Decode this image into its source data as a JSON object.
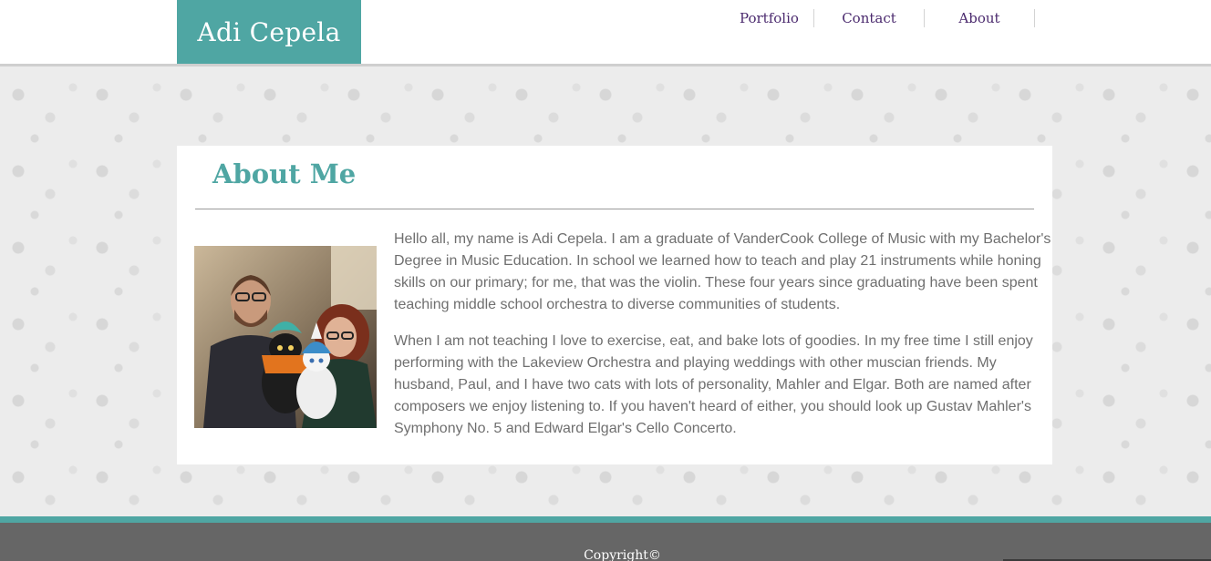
{
  "header": {
    "brand": "Adi Cepela",
    "nav": {
      "portfolio": "Portfolio",
      "contact": "Contact",
      "about": "About"
    }
  },
  "main": {
    "title": "About Me",
    "paragraphs": [
      "Hello all, my name is Adi Cepela. I am a graduate of VanderCook College of Music with my Bachelor's Degree in Music Education. In school we learned how to teach and play 21 instruments while honing skills on our primary; for me, that was the violin. These four years since graduating have been spent teaching middle school orchestra to diverse communities of students.",
      "When I am not teaching I love to exercise, eat, and bake lots of goodies. In my free time I still enjoy performing with the Lakeview Orchestra and playing weddings with other muscian friends. My husband, Paul, and I have two cats with lots of personality, Mahler and Elgar. Both are named after composers we enjoy listening to. If you haven't heard of either, you should look up Gustav Mahler's Symphony No. 5 and Edward Elgar's Cello Concerto."
    ]
  },
  "footer": {
    "copyright": "Copyright©"
  },
  "colors": {
    "accent": "#4fa6a3",
    "nav_link": "#4b2a6e",
    "footer_bg": "#666666"
  }
}
